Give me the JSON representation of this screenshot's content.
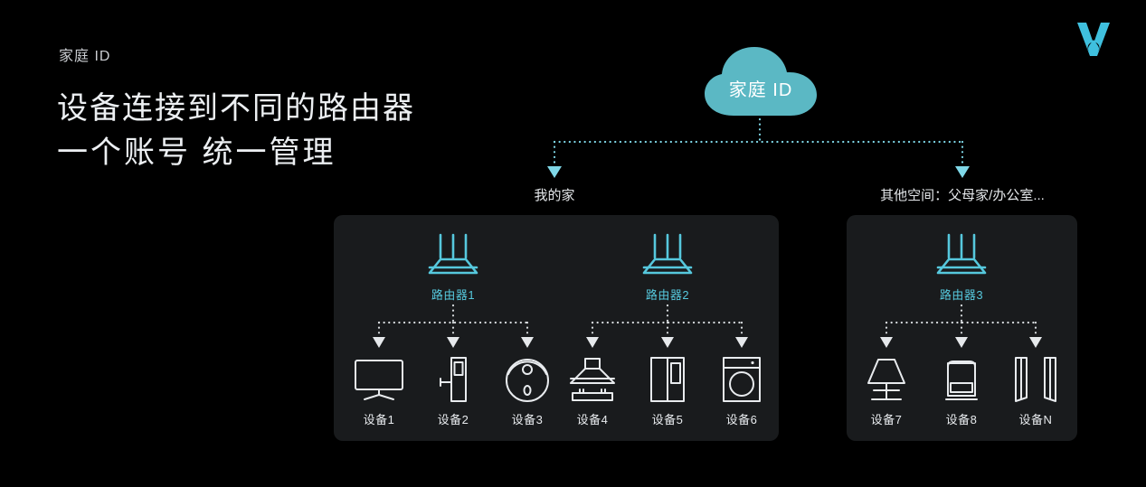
{
  "header": {
    "eyebrow": "家庭 ID",
    "title_line1": "设备连接到不同的路由器",
    "title_line2": "一个账号 统一管理",
    "logo_name": "v-logo"
  },
  "colors": {
    "background": "#000000",
    "panel": "#191b1d",
    "cloud": "#5bb8c4",
    "accent_cyan": "#56c8dd",
    "wire_cyan": "#7fd8e8",
    "wire_white": "#d8dcdf",
    "text_primary": "#eceff2",
    "text_secondary": "#c9ccd0"
  },
  "cloud": {
    "label": "家庭 ID"
  },
  "spaces": [
    {
      "label": "我的家"
    },
    {
      "label": "其他空间：父母家/办公室..."
    }
  ],
  "routers": [
    {
      "label": "路由器1",
      "icon": "router-icon"
    },
    {
      "label": "路由器2",
      "icon": "router-icon"
    },
    {
      "label": "路由器3",
      "icon": "router-icon"
    }
  ],
  "devices": [
    {
      "label": "设备1",
      "icon": "tv-icon"
    },
    {
      "label": "设备2",
      "icon": "smart-lock-icon"
    },
    {
      "label": "设备3",
      "icon": "robot-vacuum-icon"
    },
    {
      "label": "设备4",
      "icon": "range-hood-icon"
    },
    {
      "label": "设备5",
      "icon": "refrigerator-icon"
    },
    {
      "label": "设备6",
      "icon": "washing-machine-icon"
    },
    {
      "label": "设备7",
      "icon": "table-lamp-icon"
    },
    {
      "label": "设备8",
      "icon": "air-purifier-icon"
    },
    {
      "label": "设备N",
      "icon": "curtains-icon"
    }
  ]
}
